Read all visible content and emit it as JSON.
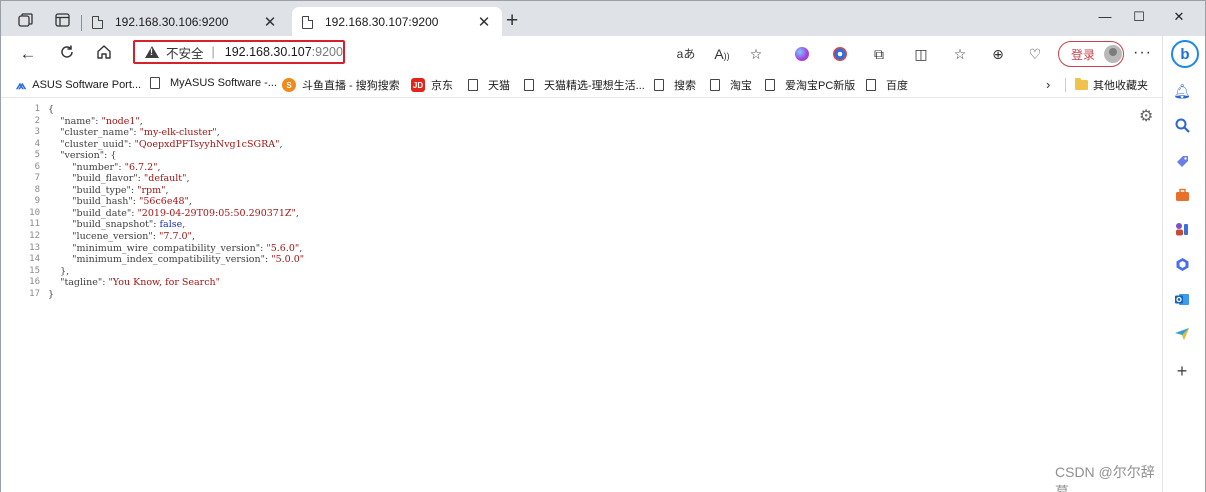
{
  "tabs": [
    {
      "title": "192.168.30.106:9200",
      "active": false
    },
    {
      "title": "192.168.30.107:9200",
      "active": true
    }
  ],
  "window_controls": {
    "minimize": "—",
    "maximize": "☐",
    "close": "✕"
  },
  "address_bar": {
    "security_label": "不安全",
    "separator": "|",
    "host": "192.168.30.107",
    "port": ":9200"
  },
  "toolbar": {
    "login_label": "登录",
    "more_label": "···"
  },
  "bookmarks": [
    {
      "label": "ASUS Software Port...",
      "icon": "asus-icon"
    },
    {
      "label": "MyASUS Software -...",
      "icon": "page-icon"
    },
    {
      "label": "斗鱼直播 - 搜狗搜索",
      "icon": "sogou-icon"
    },
    {
      "label": "京东",
      "icon": "jd-icon"
    },
    {
      "label": "天猫",
      "icon": "page-icon"
    },
    {
      "label": "天猫精选-理想生活...",
      "icon": "page-icon"
    },
    {
      "label": "搜索",
      "icon": "page-icon"
    },
    {
      "label": "淘宝",
      "icon": "page-icon"
    },
    {
      "label": "爱淘宝PC新版",
      "icon": "page-icon"
    },
    {
      "label": "百度",
      "icon": "page-icon"
    }
  ],
  "other_bookmarks_label": "其他收藏夹",
  "json_view": {
    "line_numbers": [
      "1",
      "2",
      "3",
      "4",
      "5",
      "6",
      "7",
      "8",
      "9",
      "10",
      "11",
      "12",
      "13",
      "14",
      "15",
      "16",
      "17"
    ],
    "lines": [
      [
        {
          "t": "{",
          "c": "p"
        }
      ],
      [
        {
          "t": "    \"name\"",
          "c": "k"
        },
        {
          "t": ": ",
          "c": "p"
        },
        {
          "t": "\"node1\"",
          "c": "s"
        },
        {
          "t": ",",
          "c": "p"
        }
      ],
      [
        {
          "t": "    \"cluster_name\"",
          "c": "k"
        },
        {
          "t": ": ",
          "c": "p"
        },
        {
          "t": "\"my-elk-cluster\"",
          "c": "s"
        },
        {
          "t": ",",
          "c": "p"
        }
      ],
      [
        {
          "t": "    \"cluster_uuid\"",
          "c": "k"
        },
        {
          "t": ": ",
          "c": "p"
        },
        {
          "t": "\"QoepxdPFTsyyhNvg1cSGRA\"",
          "c": "s"
        },
        {
          "t": ",",
          "c": "p"
        }
      ],
      [
        {
          "t": "    \"version\"",
          "c": "k"
        },
        {
          "t": ": {",
          "c": "p"
        }
      ],
      [
        {
          "t": "        \"number\"",
          "c": "k"
        },
        {
          "t": ": ",
          "c": "p"
        },
        {
          "t": "\"6.7.2\"",
          "c": "s"
        },
        {
          "t": ",",
          "c": "p"
        }
      ],
      [
        {
          "t": "        \"build_flavor\"",
          "c": "k"
        },
        {
          "t": ": ",
          "c": "p"
        },
        {
          "t": "\"default\"",
          "c": "s"
        },
        {
          "t": ",",
          "c": "p"
        }
      ],
      [
        {
          "t": "        \"build_type\"",
          "c": "k"
        },
        {
          "t": ": ",
          "c": "p"
        },
        {
          "t": "\"rpm\"",
          "c": "s"
        },
        {
          "t": ",",
          "c": "p"
        }
      ],
      [
        {
          "t": "        \"build_hash\"",
          "c": "k"
        },
        {
          "t": ": ",
          "c": "p"
        },
        {
          "t": "\"56c6e48\"",
          "c": "s"
        },
        {
          "t": ",",
          "c": "p"
        }
      ],
      [
        {
          "t": "        \"build_date\"",
          "c": "k"
        },
        {
          "t": ": ",
          "c": "p"
        },
        {
          "t": "\"2019-04-29T09:05:50.290371Z\"",
          "c": "s"
        },
        {
          "t": ",",
          "c": "p"
        }
      ],
      [
        {
          "t": "        \"build_snapshot\"",
          "c": "k"
        },
        {
          "t": ": ",
          "c": "p"
        },
        {
          "t": "false",
          "c": "b"
        },
        {
          "t": ",",
          "c": "p"
        }
      ],
      [
        {
          "t": "        \"lucene_version\"",
          "c": "k"
        },
        {
          "t": ": ",
          "c": "p"
        },
        {
          "t": "\"7.7.0\"",
          "c": "s"
        },
        {
          "t": ",",
          "c": "p"
        }
      ],
      [
        {
          "t": "        \"minimum_wire_compatibility_version\"",
          "c": "k"
        },
        {
          "t": ": ",
          "c": "p"
        },
        {
          "t": "\"5.6.0\"",
          "c": "s"
        },
        {
          "t": ",",
          "c": "p"
        }
      ],
      [
        {
          "t": "        \"minimum_index_compatibility_version\"",
          "c": "k"
        },
        {
          "t": ": ",
          "c": "p"
        },
        {
          "t": "\"5.0.0\"",
          "c": "s"
        }
      ],
      [
        {
          "t": "    },",
          "c": "p"
        }
      ],
      [
        {
          "t": "    \"tagline\"",
          "c": "k"
        },
        {
          "t": ": ",
          "c": "p"
        },
        {
          "t": "\"You Know, for Search\"",
          "c": "s"
        }
      ],
      [
        {
          "t": "}",
          "c": "p"
        }
      ]
    ]
  },
  "watermark": "CSDN @尔尔辞暮",
  "colors": {
    "accent_red": "#d6202c",
    "string_red": "#a31515",
    "bool_blue": "#1a2fb5"
  }
}
